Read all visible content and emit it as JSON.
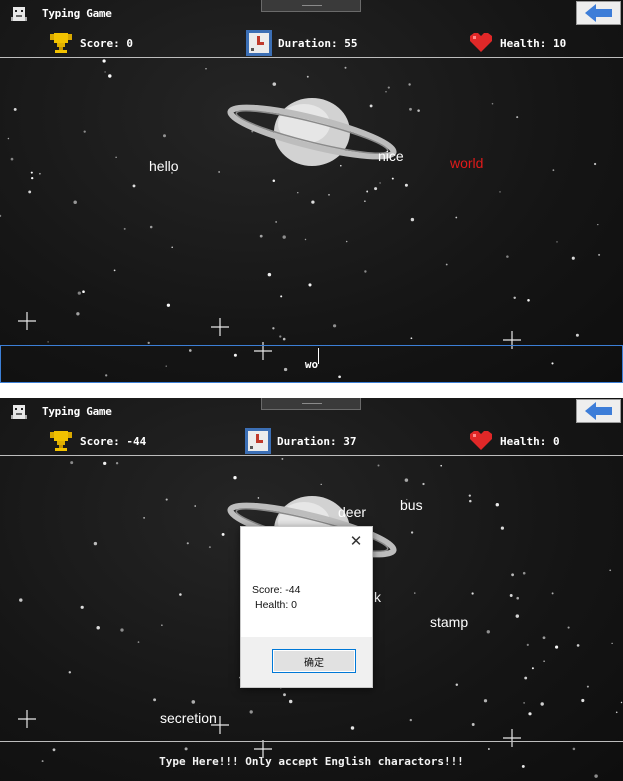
{
  "screens": [
    {
      "window": {
        "title": "Typing Game"
      },
      "status": {
        "score": "Score: 0",
        "duration": "Duration: 55",
        "health": "Health: 10"
      },
      "words": [
        {
          "text": "hello",
          "active": false
        },
        {
          "text": "nice",
          "active": false
        },
        {
          "text": "world",
          "active": true
        }
      ],
      "input": {
        "value": "wo"
      }
    },
    {
      "window": {
        "title": "Typing Game"
      },
      "status": {
        "score": "Score: -44",
        "duration": "Duration: 37",
        "health": "Health: 0"
      },
      "words": [
        {
          "text": "deer",
          "active": false
        },
        {
          "text": "bus",
          "active": false
        },
        {
          "text": "k",
          "active": false
        },
        {
          "text": "stamp",
          "active": false
        },
        {
          "text": "secretion",
          "active": false
        }
      ],
      "input": {
        "placeholder": "Type Here!!! Only accept English charactors!!!"
      },
      "dialog": {
        "score": "Score: -44",
        "health": "Health: 0",
        "ok_label": "确定"
      }
    }
  ],
  "icons": {
    "app": "pixel-mascot-icon",
    "back": "back-arrow-icon",
    "score": "trophy-icon",
    "duration": "stopwatch-icon",
    "health": "heart-icon",
    "close": "close-icon"
  },
  "colors": {
    "active_word": "#e01a1a",
    "trophy": "#f2c200",
    "heart": "#e02828",
    "back_arrow": "#3d7dd8"
  }
}
